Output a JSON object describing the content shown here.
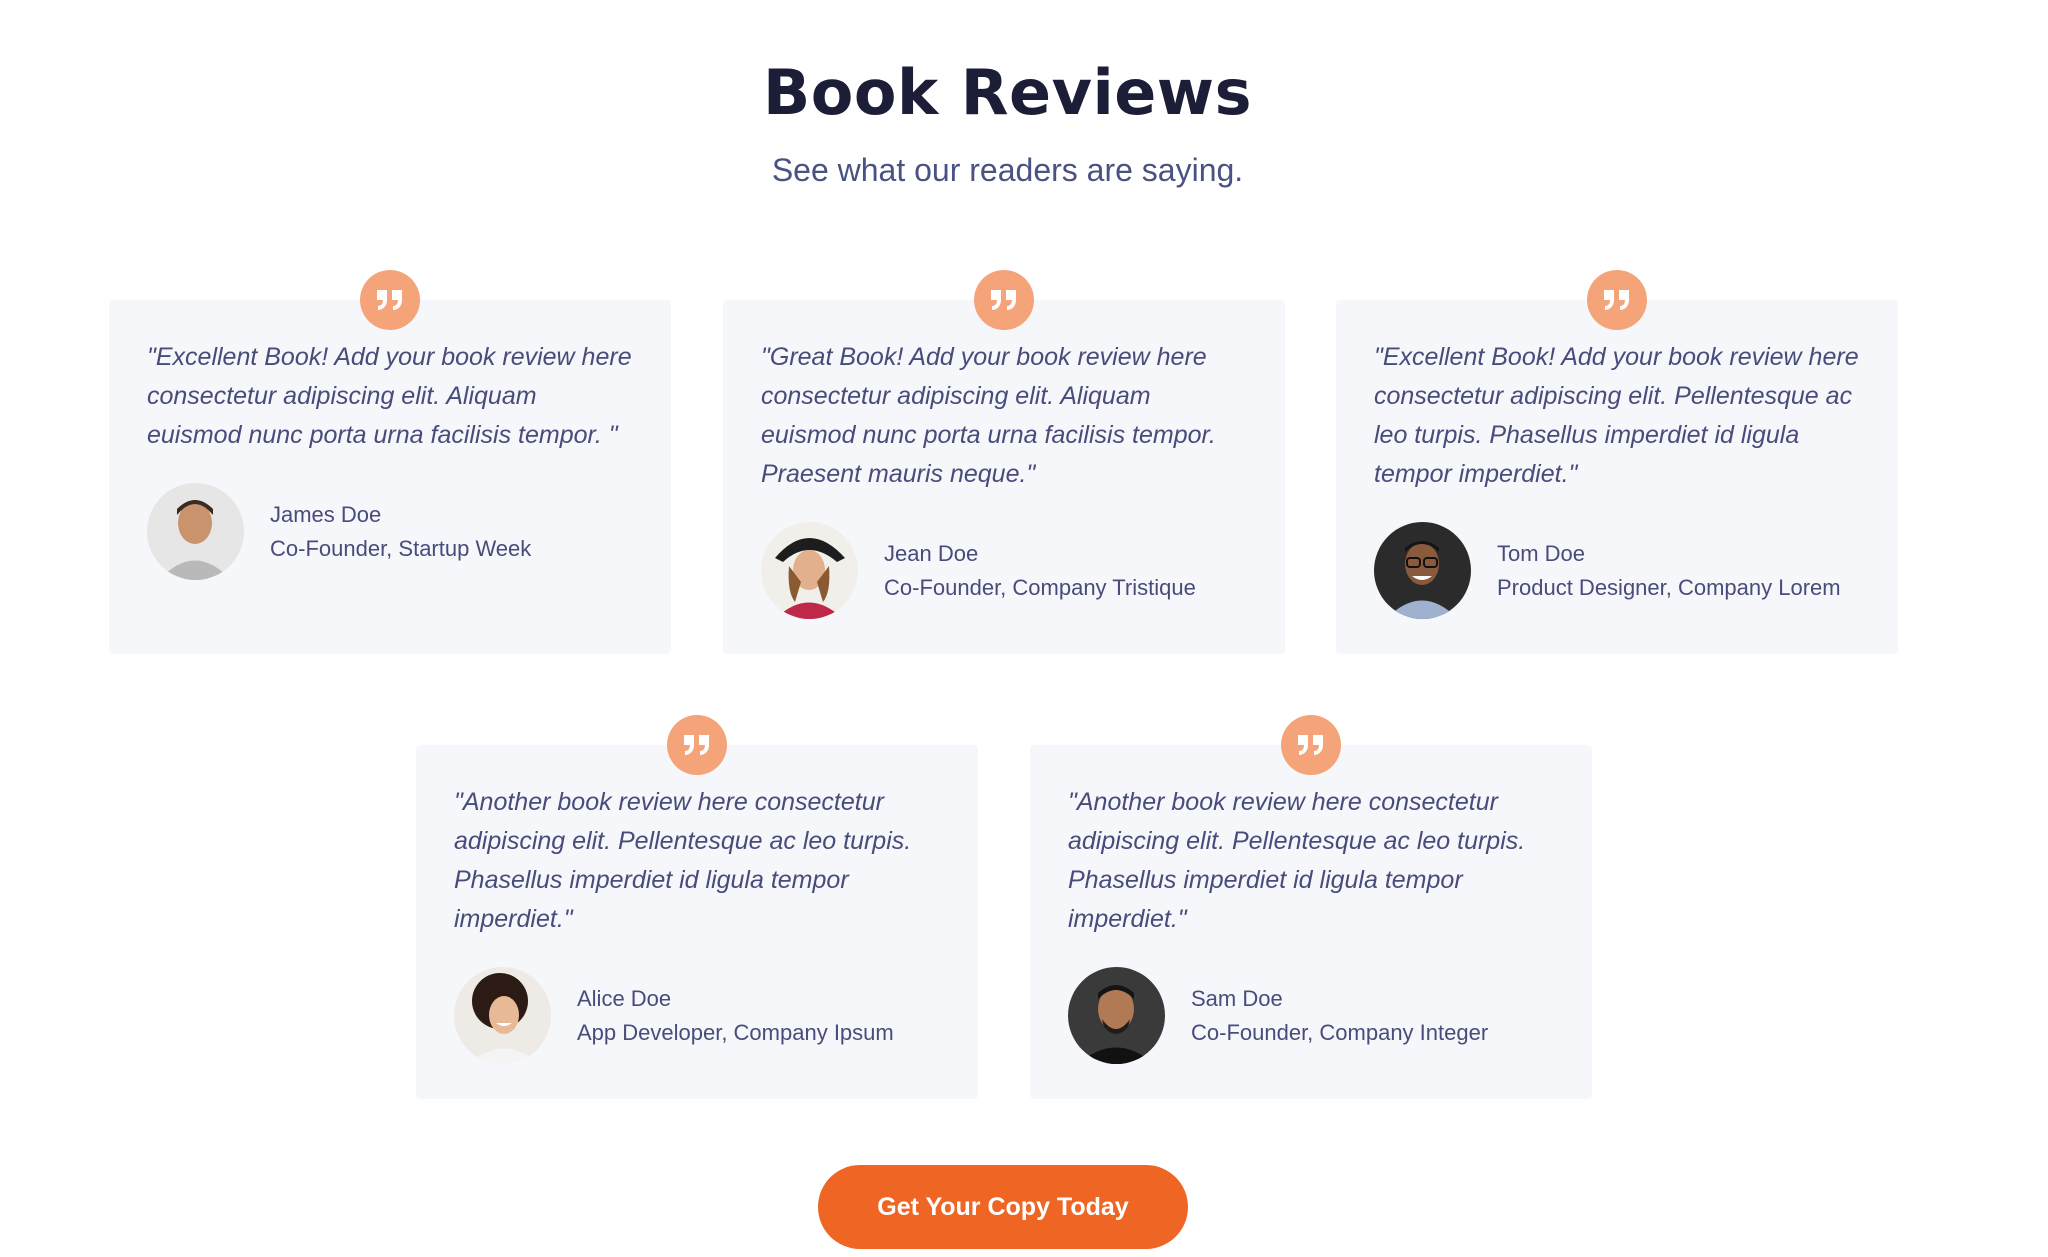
{
  "header": {
    "title": "Book Reviews",
    "subtitle": "See what our readers are saying."
  },
  "reviews": [
    {
      "text": "\"Excellent Book! Add your book review here consectetur adipiscing elit. Aliquam euismod nunc porta urna facilisis tempor. \"",
      "name": "James Doe",
      "role": "Co-Founder, Startup Week",
      "avatar_icon": "person-avatar"
    },
    {
      "text": "\"Great Book! Add your book review here consectetur adipiscing elit. Aliquam euismod nunc porta urna facilisis tempor. Praesent mauris neque.\"",
      "name": "Jean Doe",
      "role": "Co-Founder, Company Tristique",
      "avatar_icon": "person-avatar"
    },
    {
      "text": "\"Excellent Book! Add your book review here consectetur adipiscing elit. Pellentesque ac leo turpis. Phasellus imperdiet id ligula tempor imperdiet.\"",
      "name": "Tom Doe",
      "role": "Product Designer, Company Lorem",
      "avatar_icon": "person-avatar"
    },
    {
      "text": "\"Another book review here consectetur adipiscing elit. Pellentesque ac leo turpis. Phasellus imperdiet id ligula tempor imperdiet.\"",
      "name": "Alice Doe",
      "role": "App Developer, Company Ipsum",
      "avatar_icon": "person-avatar"
    },
    {
      "text": "\"Another book review here consectetur adipiscing elit. Pellentesque ac leo turpis. Phasellus imperdiet id ligula tempor imperdiet.\"",
      "name": "Sam Doe",
      "role": "Co-Founder, Company Integer",
      "avatar_icon": "person-avatar"
    }
  ],
  "cta": {
    "label": "Get Your Copy Today"
  },
  "colors": {
    "accent": "#ef6624",
    "quote_badge": "#f5a47a",
    "card_background": "#f6f7fb",
    "heading": "#1c1d36",
    "body_text": "#474c7a"
  }
}
